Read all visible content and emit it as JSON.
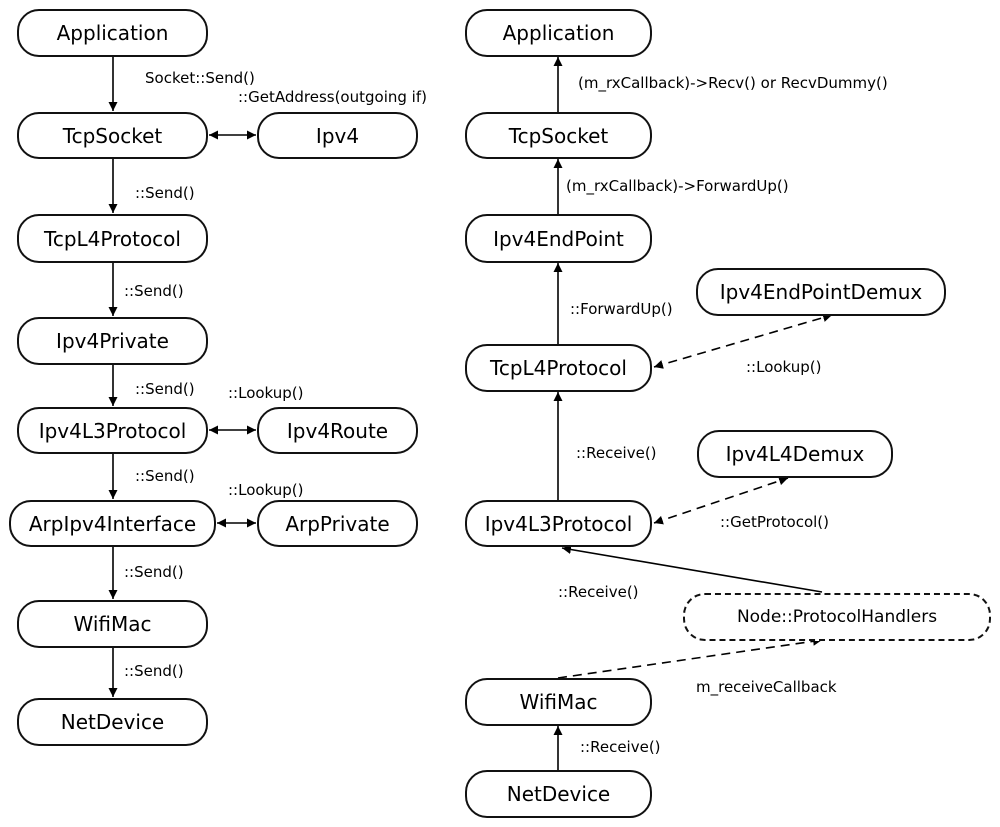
{
  "send_path": {
    "nodes": {
      "application": "Application",
      "tcp_socket": "TcpSocket",
      "ipv4": "Ipv4",
      "tcp_l4_protocol": "TcpL4Protocol",
      "ipv4_private": "Ipv4Private",
      "ipv4_l3_protocol": "Ipv4L3Protocol",
      "ipv4_route": "Ipv4Route",
      "arp_ipv4_interface": "ArpIpv4Interface",
      "arp_private": "ArpPrivate",
      "wifi_mac": "WifiMac",
      "net_device": "NetDevice"
    },
    "edges": {
      "app_to_socket": "Socket::Send()",
      "socket_ipv4": "::GetAddress(outgoing if)",
      "socket_to_l4": "::Send()",
      "l4_to_private": "::Send()",
      "private_to_l3": "::Send()",
      "l3_route": "::Lookup()",
      "l3_to_arp": "::Send()",
      "arp_private": "::Lookup()",
      "arp_to_wifi": "::Send()",
      "wifi_to_netdev": "::Send()"
    }
  },
  "receive_path": {
    "nodes": {
      "application": "Application",
      "tcp_socket": "TcpSocket",
      "ipv4_endpoint": "Ipv4EndPoint",
      "ipv4_endpoint_demux": "Ipv4EndPointDemux",
      "tcp_l4_protocol": "TcpL4Protocol",
      "ipv4_l4_demux": "Ipv4L4Demux",
      "ipv4_l3_protocol": "Ipv4L3Protocol",
      "protocol_handlers": "Node::ProtocolHandlers",
      "wifi_mac": "WifiMac",
      "net_device": "NetDevice"
    },
    "edges": {
      "socket_to_app": "(m_rxCallback)->Recv() or RecvDummy()",
      "endpoint_to_socket": "(m_rxCallback)->ForwardUp()",
      "l4_to_endpoint": "::ForwardUp()",
      "l4_demux_lookup": "::Lookup()",
      "l3_to_l4": "::Receive()",
      "l3_get_protocol": "::GetProtocol()",
      "handlers_to_l3": "::Receive()",
      "wifi_to_handlers": "m_receiveCallback",
      "netdev_to_wifi": "::Receive()"
    }
  }
}
